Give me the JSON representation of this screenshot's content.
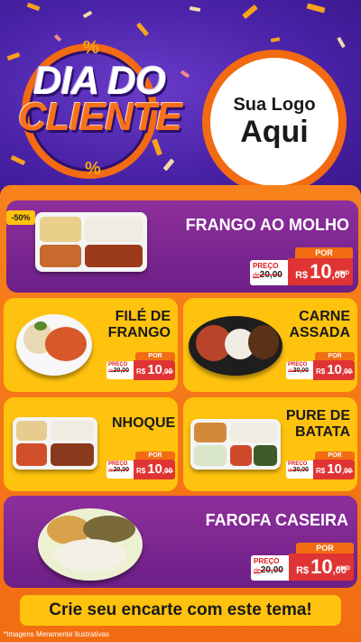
{
  "header": {
    "title_line1": "DIA DO",
    "title_line2": "CLIENTE",
    "percent_symbol": "%",
    "logo_line1": "Sua Logo",
    "logo_line2": "Aqui"
  },
  "badge": "-50%",
  "items": [
    {
      "name": "FRANGO AO MOLHO",
      "price_label": "PREÇO",
      "old_prefix": "de",
      "old_price": "20,00",
      "por": "POR",
      "currency": "R$",
      "price_int": "10",
      "price_cents": ",00",
      "unit": "UNID"
    },
    {
      "name_line1": "FILÉ DE",
      "name_line2": "FRANGO",
      "price_label": "PREÇO",
      "old_prefix": "de",
      "old_price": "20,00",
      "por": "POR",
      "currency": "R$",
      "price_int": "10",
      "price_cents": ",00",
      "unit": "UNID"
    },
    {
      "name_line1": "CARNE",
      "name_line2": "ASSADA",
      "price_label": "PREÇO",
      "old_prefix": "de",
      "old_price": "20,00",
      "por": "POR",
      "currency": "R$",
      "price_int": "10",
      "price_cents": ",00",
      "unit": "UNID"
    },
    {
      "name": "NHOQUE",
      "price_label": "PREÇO",
      "old_prefix": "de",
      "old_price": "20,00",
      "por": "POR",
      "currency": "R$",
      "price_int": "10",
      "price_cents": ",00",
      "unit": "UNID"
    },
    {
      "name_line1": "PURE DE",
      "name_line2": "BATATA",
      "price_label": "PREÇO",
      "old_prefix": "de",
      "old_price": "20,00",
      "por": "POR",
      "currency": "R$",
      "price_int": "10",
      "price_cents": ",00",
      "unit": "UNID"
    },
    {
      "name": "FAROFA CASEIRA",
      "price_label": "PREÇO",
      "old_prefix": "de",
      "old_price": "20,00",
      "por": "POR",
      "currency": "R$",
      "price_int": "10",
      "price_cents": ",00",
      "unit": "UNID"
    }
  ],
  "cta": "Crie seu encarte com este tema!",
  "disclaimer": "*Imagens Meramente Ilustrativas",
  "colors": {
    "purple": "#6d1f87",
    "orange": "#f26d12",
    "yellow": "#ffc20e",
    "red": "#e03434",
    "header_bg": "#4a23a8"
  }
}
